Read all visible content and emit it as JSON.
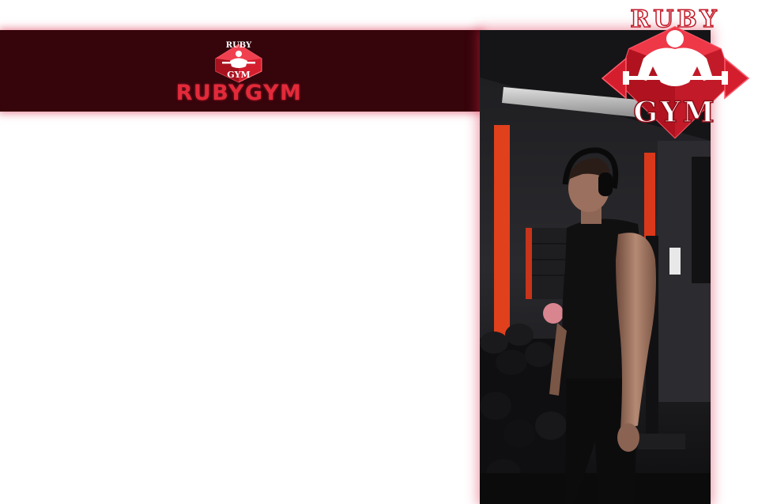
{
  "header": {
    "brand_name": "RUBYGYM",
    "logo_top_text": "RUBY",
    "logo_bottom_text": "GYM"
  },
  "badge": {
    "top_text": "RUBY",
    "bottom_text": "GYM"
  },
  "photo": {
    "subject": "athlete in black tank top with headphones standing beside a dumbbell rack"
  },
  "colors": {
    "header_background": "#36040b",
    "brand_red": "#e32a3a",
    "ruby_red": "#d41e2e",
    "glow": "#ff3c50",
    "column_orange": "#e0401c"
  }
}
